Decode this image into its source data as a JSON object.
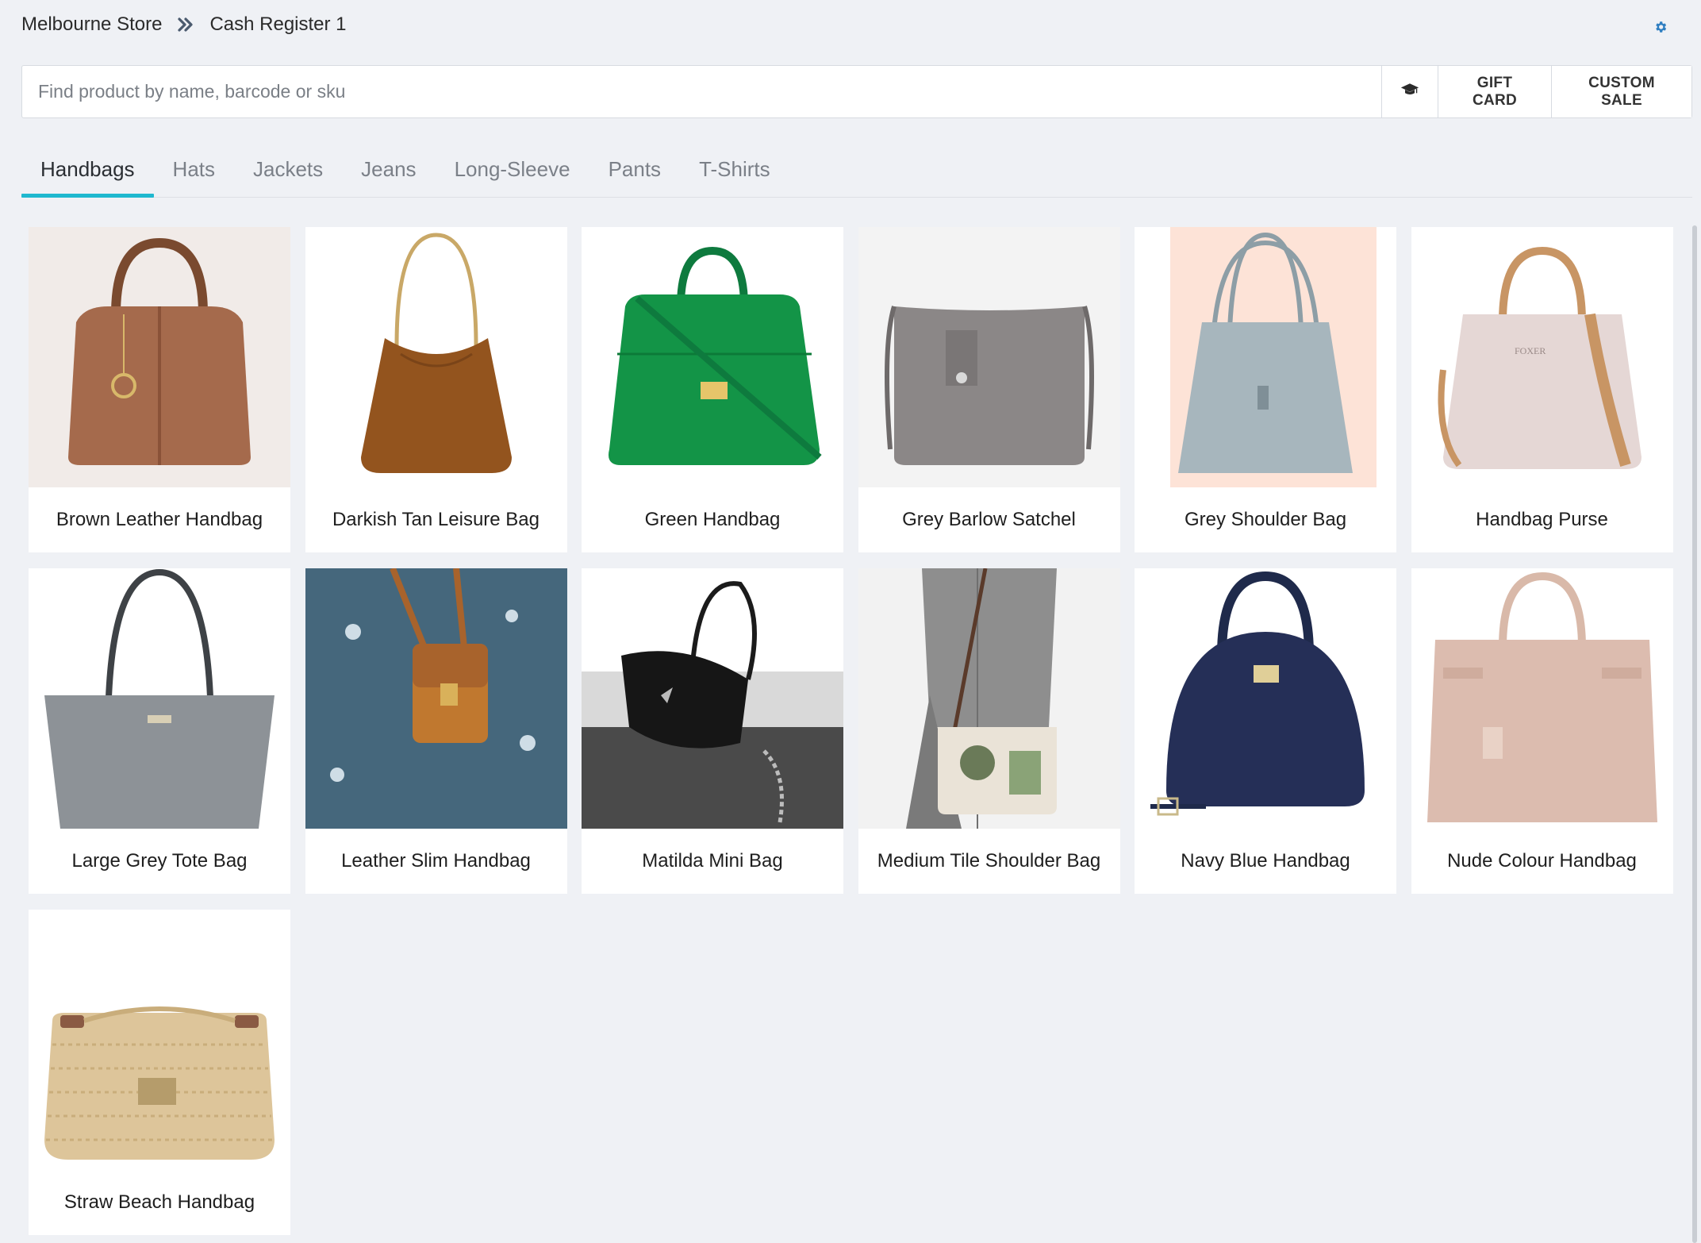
{
  "breadcrumb": {
    "store": "Melbourne Store",
    "register": "Cash Register 1"
  },
  "search": {
    "placeholder": "Find product by name, barcode or sku",
    "value": ""
  },
  "toolbar": {
    "gift_card_label": "GIFT CARD",
    "custom_sale_label": "CUSTOM SALE"
  },
  "tabs": [
    {
      "label": "Handbags",
      "active": true
    },
    {
      "label": "Hats"
    },
    {
      "label": "Jackets"
    },
    {
      "label": "Jeans"
    },
    {
      "label": "Long-Sleeve"
    },
    {
      "label": "Pants"
    },
    {
      "label": "T-Shirts"
    }
  ],
  "products": [
    {
      "name": "Brown Leather Handbag"
    },
    {
      "name": "Darkish Tan Leisure Bag"
    },
    {
      "name": "Green Handbag"
    },
    {
      "name": "Grey Barlow Satchel"
    },
    {
      "name": "Grey Shoulder Bag"
    },
    {
      "name": "Handbag Purse"
    },
    {
      "name": "Large Grey Tote Bag"
    },
    {
      "name": "Leather Slim Handbag"
    },
    {
      "name": "Matilda Mini Bag"
    },
    {
      "name": "Medium Tile Shoulder Bag"
    },
    {
      "name": "Navy Blue Handbag"
    },
    {
      "name": "Nude Colour Handbag"
    },
    {
      "name": "Straw Beach Handbag"
    }
  ],
  "colors": {
    "accent": "#1fb8cf",
    "background": "#eff1f5",
    "settings_icon": "#2f7fc1"
  }
}
